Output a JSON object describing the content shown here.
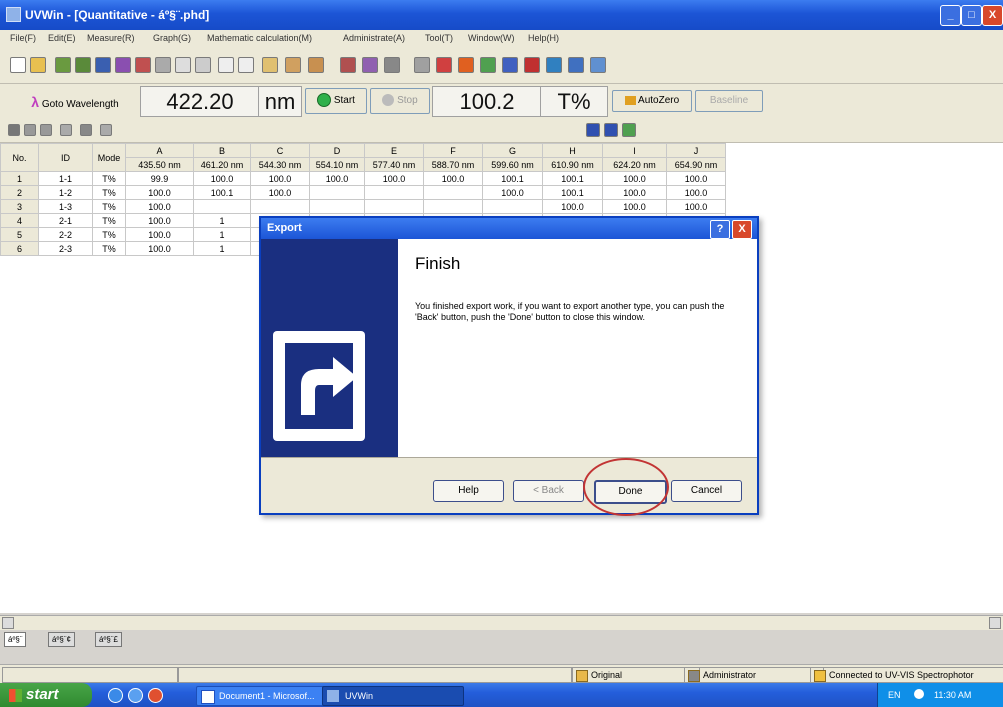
{
  "window": {
    "title": "UVWin - [Quantitative - áº§¨.phd]",
    "min": "_",
    "max": "□",
    "close": "X"
  },
  "menu": [
    "File(F)",
    "Edit(E)",
    "Measure(R)",
    "Graph(G)",
    "Mathematic calculation(M)",
    "Administrate(A)",
    "Tool(T)",
    "Window(W)",
    "Help(H)"
  ],
  "toolbar": {
    "goto_label": "Goto Wavelength",
    "wavelength": "422.20",
    "unit": "nm",
    "start": "Start",
    "stop": "Stop",
    "reading": "100.2",
    "reading_unit": "T%",
    "autozero": "AutoZero",
    "baseline": "Baseline"
  },
  "table": {
    "head_no": "No.",
    "head_id": "ID",
    "head_mode": "Mode",
    "letters": [
      "A",
      "B",
      "C",
      "D",
      "E",
      "F",
      "G",
      "H",
      "I",
      "J"
    ],
    "wavelengths": [
      "435.50 nm",
      "461.20 nm",
      "544.30 nm",
      "554.10 nm",
      "577.40 nm",
      "588.70 nm",
      "599.60 nm",
      "610.90 nm",
      "624.20 nm",
      "654.90 nm"
    ],
    "rows": [
      {
        "no": "1",
        "id": "1-1",
        "mode": "T%",
        "v": [
          "99.9",
          "100.0",
          "100.0",
          "100.0",
          "100.0",
          "100.0",
          "100.1",
          "100.1",
          "100.0",
          "100.0"
        ]
      },
      {
        "no": "2",
        "id": "1-2",
        "mode": "T%",
        "v": [
          "100.0",
          "100.1",
          "100.0",
          "",
          "",
          "",
          "100.0",
          "100.1",
          "100.0",
          "100.0"
        ]
      },
      {
        "no": "3",
        "id": "1-3",
        "mode": "T%",
        "v": [
          "100.0",
          "",
          "",
          "",
          "",
          "",
          "",
          "100.0",
          "100.0",
          "100.0"
        ]
      },
      {
        "no": "4",
        "id": "2-1",
        "mode": "T%",
        "v": [
          "100.0",
          "1",
          "",
          "",
          "",
          "",
          "",
          "",
          "100.1",
          "100.0"
        ]
      },
      {
        "no": "5",
        "id": "2-2",
        "mode": "T%",
        "v": [
          "100.0",
          "1",
          "",
          "",
          "",
          "",
          "",
          "",
          "100.1",
          "100.0"
        ]
      },
      {
        "no": "6",
        "id": "2-3",
        "mode": "T%",
        "v": [
          "100.0",
          "1",
          "",
          "",
          "",
          "",
          "",
          "",
          "100.0",
          "100.0"
        ]
      }
    ]
  },
  "sheet_tabs": [
    "áº§¨",
    "áº§¨¢",
    "áº§¨£"
  ],
  "status": {
    "original": "Original",
    "user": "Administrator",
    "connection": "Connected to UV-VIS Spectrophotor"
  },
  "taskbar": {
    "start": "start",
    "doc": "Document1 - Microsof...",
    "app": "UVWin",
    "lang": "EN",
    "clock": "11:30 AM"
  },
  "dialog": {
    "title": "Export",
    "help_icon": "?",
    "close_icon": "X",
    "heading": "Finish",
    "message": "You finished export work, if you want to export another type, you can push the 'Back' button, push the 'Done' button to close this window.",
    "help": "Help",
    "back": "< Back",
    "done": "Done",
    "cancel": "Cancel"
  },
  "colors": {
    "title": "#1c55d6",
    "highlight_circle": "#c23434",
    "dialog_side": "#1a2f80"
  }
}
